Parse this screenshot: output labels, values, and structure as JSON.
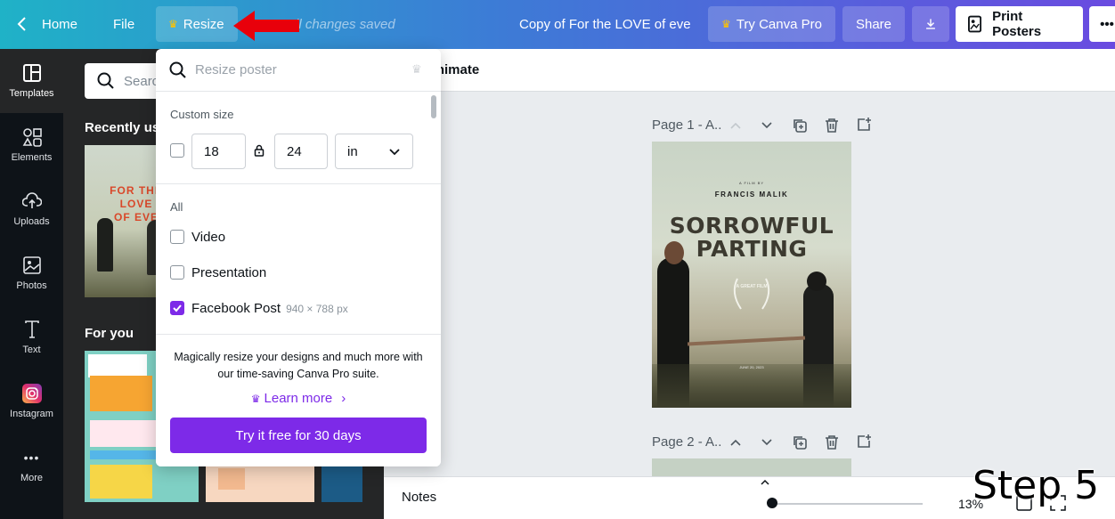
{
  "topbar": {
    "home": "Home",
    "file": "File",
    "resize": "Resize",
    "saved": "All changes saved",
    "doc_title": "Copy of For the LOVE of eve",
    "try_pro": "Try Canva Pro",
    "share": "Share",
    "print": "Print Posters"
  },
  "rail": [
    {
      "label": "Templates",
      "icon": "templates-icon"
    },
    {
      "label": "Elements",
      "icon": "elements-icon"
    },
    {
      "label": "Uploads",
      "icon": "uploads-icon"
    },
    {
      "label": "Photos",
      "icon": "photos-icon"
    },
    {
      "label": "Text",
      "icon": "text-icon"
    },
    {
      "label": "Instagram",
      "icon": "instagram-icon"
    },
    {
      "label": "More",
      "icon": "more-dots-icon"
    }
  ],
  "panel": {
    "search_placeholder": "Search",
    "recently_used": "Recently used",
    "for_you": "For you"
  },
  "resize_dropdown": {
    "search_placeholder": "Resize poster",
    "custom_size_label": "Custom size",
    "width": "18",
    "height": "24",
    "unit": "in",
    "all_label": "All",
    "options": [
      {
        "label": "Video",
        "checked": false,
        "dims": ""
      },
      {
        "label": "Presentation",
        "checked": false,
        "dims": ""
      },
      {
        "label": "Facebook Post",
        "checked": true,
        "dims": "940 × 788 px"
      }
    ],
    "promo_text": "Magically resize your designs and much more with our time-saving Canva Pro suite.",
    "learn_more": "Learn more",
    "try_free": "Try it free for 30 days"
  },
  "canvas": {
    "animate": "Animate",
    "page1": "Page 1 - A..",
    "page2": "Page 2 - A..",
    "notes": "Notes",
    "zoom": "13%",
    "zoom_level": 0.13
  },
  "poster": {
    "film_by": "A FILM BY",
    "director": "FRANCIS MALIK",
    "title_line1": "SORROWFUL",
    "title_line2": "PARTING",
    "award": "A GREAT FILM",
    "date": "JUNE 20, 2023"
  },
  "overlay": {
    "step": "Step 5"
  },
  "colors": {
    "accent": "#7d2ae8",
    "topbar_start": "#1fb2c7",
    "topbar_end": "#6a4be0",
    "arrow": "#e8000b"
  }
}
